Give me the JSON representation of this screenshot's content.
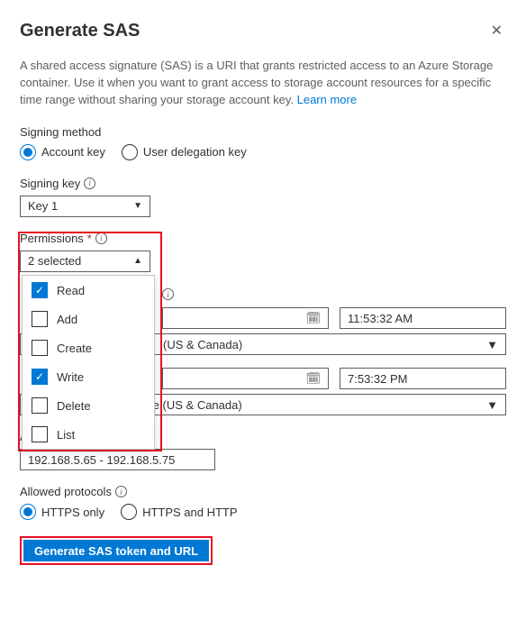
{
  "header": {
    "title": "Generate SAS"
  },
  "description": {
    "text": "A shared access signature (SAS) is a URI that grants restricted access to an Azure Storage container. Use it when you want to grant access to storage account resources for a specific time range without sharing your storage account key.",
    "learn_more": "Learn more"
  },
  "signing_method": {
    "label": "Signing method",
    "options": [
      "Account key",
      "User delegation key"
    ],
    "selected": "Account key"
  },
  "signing_key": {
    "label": "Signing key",
    "value": "Key 1"
  },
  "permissions": {
    "label": "Permissions",
    "summary": "2 selected",
    "options": [
      {
        "label": "Read",
        "checked": true
      },
      {
        "label": "Add",
        "checked": false
      },
      {
        "label": "Create",
        "checked": false
      },
      {
        "label": "Write",
        "checked": true
      },
      {
        "label": "Delete",
        "checked": false
      },
      {
        "label": "List",
        "checked": false
      }
    ]
  },
  "start": {
    "time": "11:53:32 AM",
    "timezone": "(US & Canada)"
  },
  "expiry": {
    "time": "7:53:32 PM",
    "timezone_full": "(UTC-08:00) Pacific Time (US & Canada)"
  },
  "allowed_ip": {
    "label": "Allowed IP addresses",
    "value": "192.168.5.65 - 192.168.5.75"
  },
  "allowed_protocols": {
    "label": "Allowed protocols",
    "options": [
      "HTTPS only",
      "HTTPS and HTTP"
    ],
    "selected": "HTTPS only"
  },
  "generate_button": "Generate SAS token and URL"
}
